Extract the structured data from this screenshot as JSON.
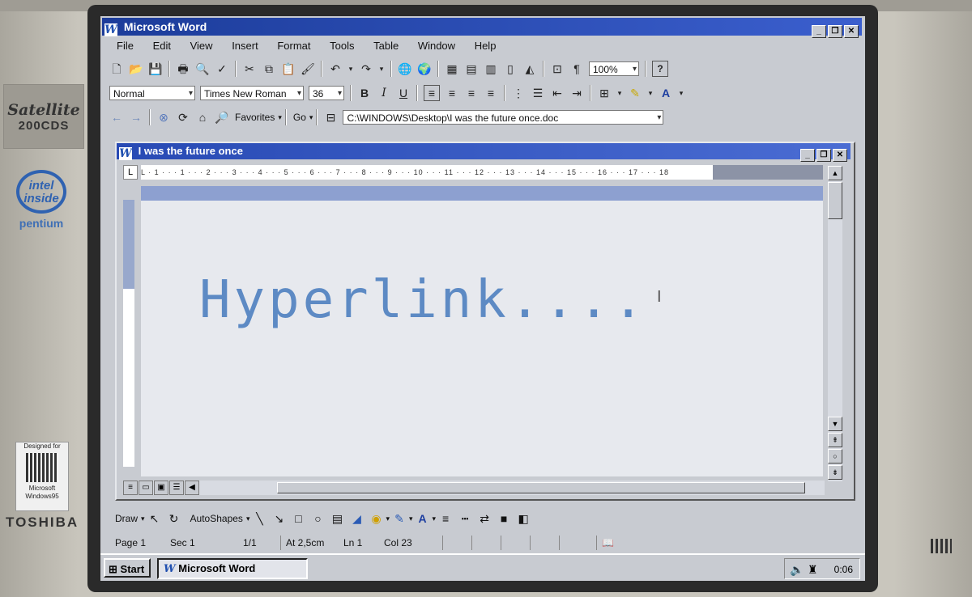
{
  "bezel": {
    "brand_line1": "Satellite",
    "brand_line2": "200CDS",
    "intel_text": "intel inside",
    "intel_sub": "pentium",
    "win95_top": "Designed for",
    "win95_bottom": "Microsoft Windows95",
    "maker": "TOSHIBA"
  },
  "app": {
    "title": "Microsoft Word",
    "title_icon": "W"
  },
  "menu": [
    "File",
    "Edit",
    "View",
    "Insert",
    "Format",
    "Tools",
    "Table",
    "Window",
    "Help"
  ],
  "format_bar": {
    "style": "Normal",
    "font": "Times New Roman",
    "size": "36",
    "bold": "B",
    "italic": "I",
    "underline": "U"
  },
  "standard_bar": {
    "zoom": "100%",
    "pilcrow": "¶",
    "help": "?"
  },
  "web_bar": {
    "favorites": "Favorites",
    "go": "Go",
    "address": "C:\\WINDOWS\\Desktop\\I was the future once.doc"
  },
  "document": {
    "title": "I was the future once",
    "body_text": "Hyperlink....",
    "ruler_text": "L · 1 · · · 1 · · · 2 · · · 3 · · · 4 · · · 5 · · · 6 · · · 7 · · · 8 · · · 9 · · · 10 · · · 11 · · · 12 · · · 13 · · · 14 · · · 15 · · · 16 · · · 17 · · · 18"
  },
  "draw_bar": {
    "draw": "Draw",
    "autoshapes": "AutoShapes"
  },
  "status": {
    "page": "Page 1",
    "sec": "Sec 1",
    "pages": "1/1",
    "at": "At 2,5cm",
    "ln": "Ln 1",
    "col": "Col 23"
  },
  "taskbar": {
    "start": "Start",
    "task": "Microsoft Word",
    "clock": "0:06"
  },
  "colors": {
    "title_bar": "#1c3c9a",
    "body_text": "#5d8ac4",
    "chrome": "#c8cbd1"
  }
}
